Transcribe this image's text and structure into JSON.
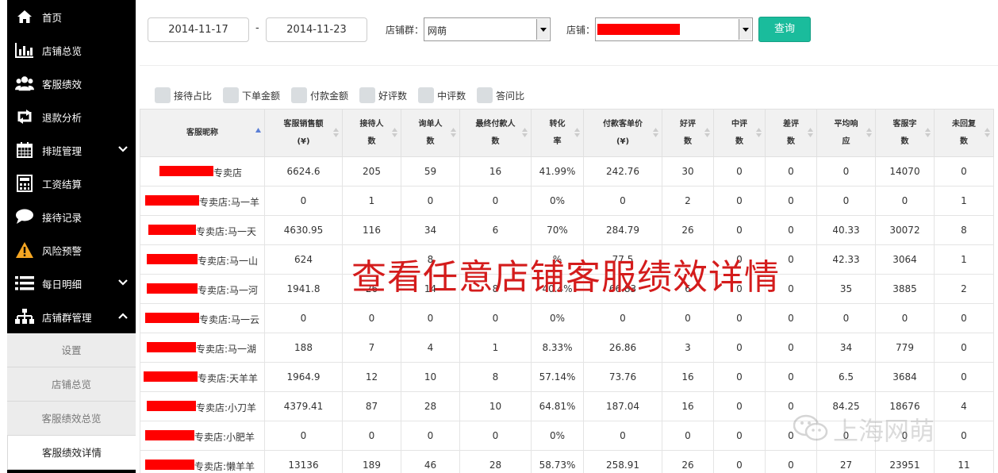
{
  "sidebar": {
    "items": [
      {
        "label": "首页",
        "icon": "home-icon"
      },
      {
        "label": "店铺总览",
        "icon": "bar-chart-icon"
      },
      {
        "label": "客服绩效",
        "icon": "users-icon"
      },
      {
        "label": "退款分析",
        "icon": "retweet-icon"
      },
      {
        "label": "排班管理",
        "icon": "calendar-icon",
        "chevron": "down"
      },
      {
        "label": "工资结算",
        "icon": "calculator-icon"
      },
      {
        "label": "接待记录",
        "icon": "comment-icon"
      },
      {
        "label": "风险预警",
        "icon": "warning-icon"
      },
      {
        "label": "每日明细",
        "icon": "list-icon",
        "chevron": "down"
      },
      {
        "label": "店铺群管理",
        "icon": "sitemap-icon",
        "chevron": "up"
      }
    ],
    "subitems": [
      {
        "label": "设置"
      },
      {
        "label": "店铺总览"
      },
      {
        "label": "客服绩效总览"
      },
      {
        "label": "客服绩效详情",
        "active": true
      }
    ]
  },
  "toolbar": {
    "start_date": "2014-11-17",
    "date_separator": "-",
    "end_date": "2014-11-23",
    "group_label": "店铺群：",
    "group_value": "网萌",
    "shop_label": "店铺：",
    "query_label": "查询"
  },
  "toggles": [
    "接待占比",
    "下单金额",
    "付款金额",
    "好评数",
    "中评数",
    "答问比"
  ],
  "table": {
    "headers": [
      [
        "客服昵称"
      ],
      [
        "客服销售额",
        "(¥)"
      ],
      [
        "接待人",
        "数"
      ],
      [
        "询单人",
        "数"
      ],
      [
        "最终付款人",
        "数"
      ],
      [
        "转化",
        "率"
      ],
      [
        "付款客单价",
        "(¥)"
      ],
      [
        "好评",
        "数"
      ],
      [
        "中评",
        "数"
      ],
      [
        "差评",
        "数"
      ],
      [
        "平均响",
        "应"
      ],
      [
        "客服字",
        "数"
      ],
      [
        "未回复",
        "数"
      ]
    ],
    "rows": [
      {
        "name": "专卖店",
        "cells": [
          "6624.6",
          "205",
          "59",
          "16",
          "41.99%",
          "242.76",
          "30",
          "0",
          "0",
          "0",
          "14070",
          "0"
        ]
      },
      {
        "name": "专卖店:马一羊",
        "cells": [
          "0",
          "1",
          "0",
          "0",
          "0%",
          "0",
          "2",
          "0",
          "0",
          "0",
          "0",
          "1"
        ]
      },
      {
        "name": "专卖店:马一天",
        "cells": [
          "4630.95",
          "116",
          "34",
          "6",
          "70%",
          "284.79",
          "26",
          "0",
          "0",
          "40.33",
          "30072",
          "8"
        ]
      },
      {
        "name": "专卖店:马一山",
        "cells": [
          "624",
          "",
          "8",
          "",
          "%",
          "77.5",
          "",
          "0",
          "0",
          "42.33",
          "3064",
          "1"
        ]
      },
      {
        "name": "专卖店:马一河",
        "cells": [
          "1941.8",
          "26",
          "14",
          "8",
          "40.4%",
          "66.83",
          "6",
          "0",
          "0",
          "35",
          "3885",
          "2"
        ]
      },
      {
        "name": "专卖店:马一云",
        "cells": [
          "0",
          "0",
          "0",
          "0",
          "0%",
          "0",
          "0",
          "0",
          "0",
          "0",
          "0",
          "0"
        ]
      },
      {
        "name": "专卖店:马一湖",
        "cells": [
          "188",
          "7",
          "4",
          "1",
          "8.33%",
          "26.86",
          "3",
          "0",
          "0",
          "34",
          "779",
          "0"
        ]
      },
      {
        "name": "专卖店:天羊羊",
        "cells": [
          "1964.9",
          "12",
          "10",
          "8",
          "57.14%",
          "73.76",
          "16",
          "0",
          "0",
          "6.5",
          "3684",
          "0"
        ]
      },
      {
        "name": "专卖店:小刀羊",
        "cells": [
          "4379.41",
          "87",
          "28",
          "10",
          "64.81%",
          "187.04",
          "16",
          "0",
          "0",
          "84.25",
          "18676",
          "4"
        ]
      },
      {
        "name": "专卖店:小肥羊",
        "cells": [
          "0",
          "0",
          "0",
          "0",
          "0%",
          "0",
          "0",
          "0",
          "0",
          "0",
          "0",
          "0"
        ]
      },
      {
        "name": "专卖店:懒羊羊",
        "cells": [
          "13136",
          "189",
          "46",
          "28",
          "58.73%",
          "258.91",
          "26",
          "0",
          "0",
          "27",
          "23951",
          "11"
        ]
      }
    ]
  },
  "overlay": {
    "title": "查看任意店铺客服绩效详情",
    "watermark": "上海网萌"
  },
  "colors": {
    "sidebar_bg": "#000000",
    "accent": "#1abc9c",
    "overlay_red": "#d41c1c",
    "redaction": "#ff0000"
  }
}
